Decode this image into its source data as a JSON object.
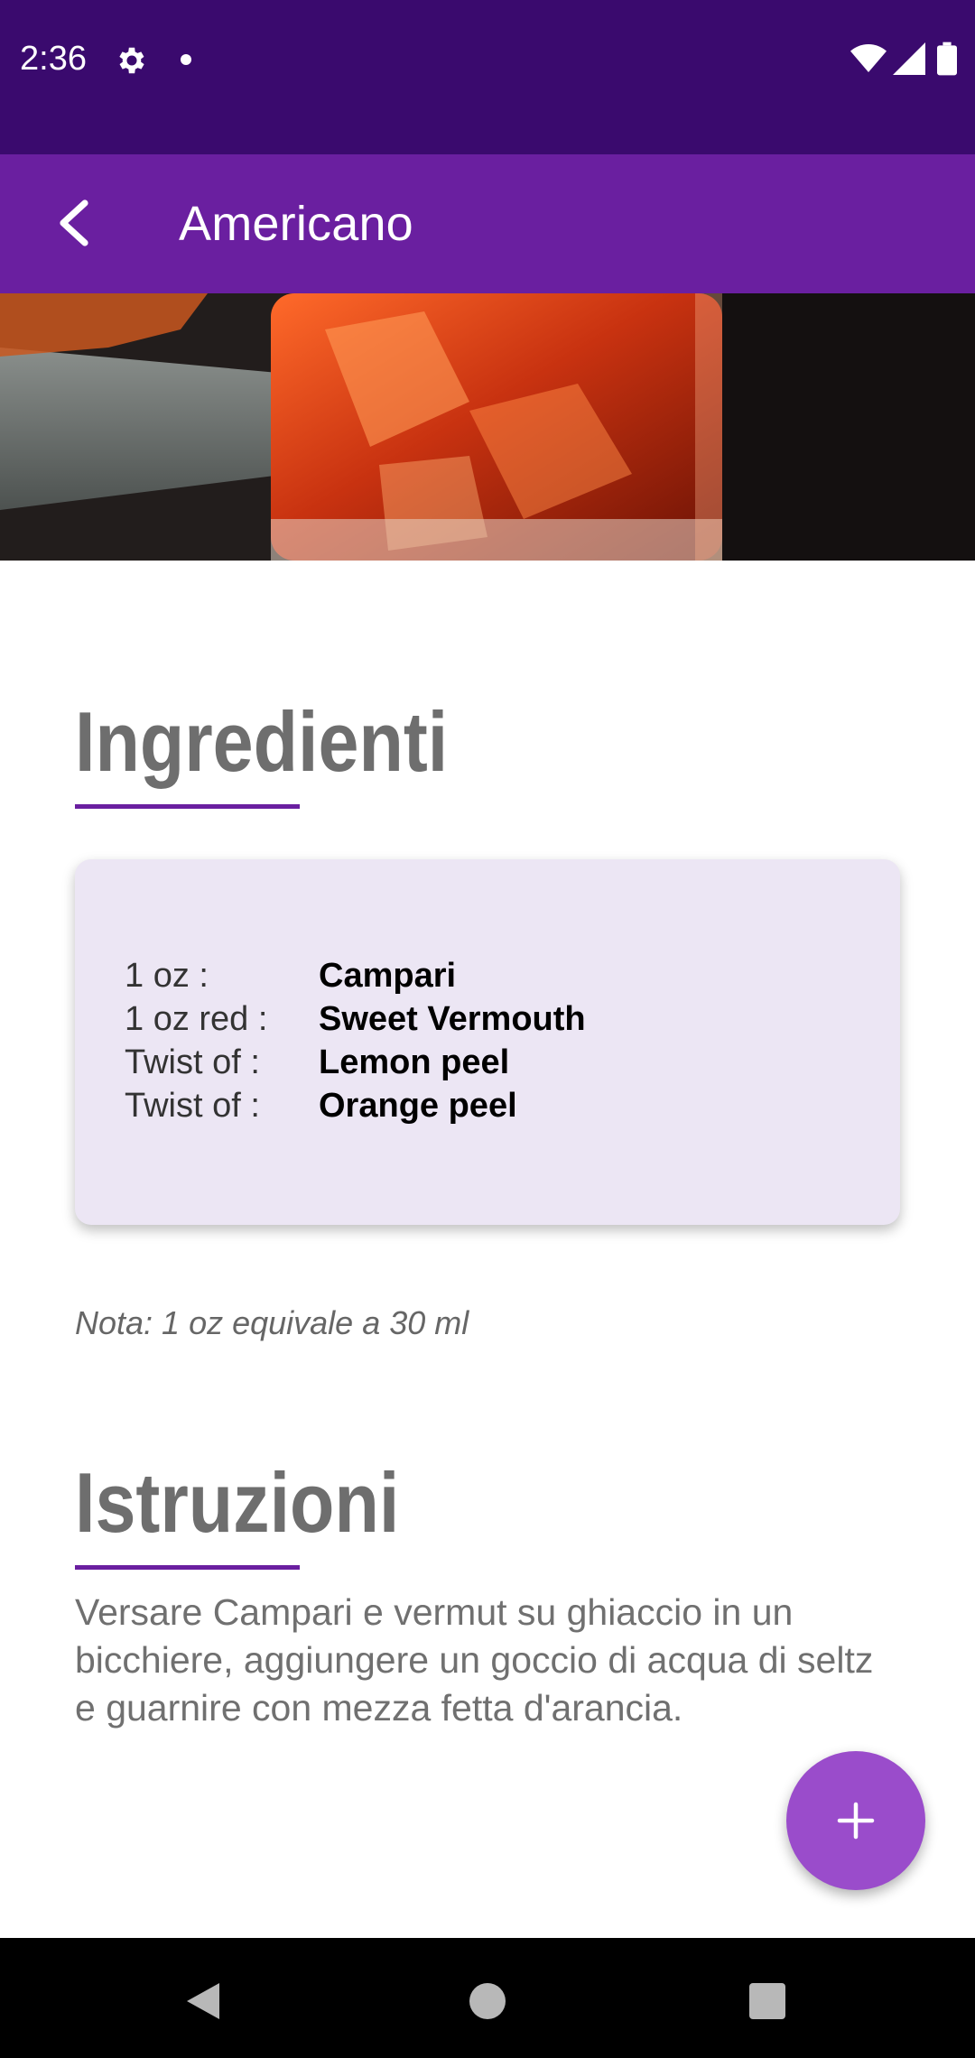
{
  "status_bar": {
    "time": "2:36"
  },
  "app_bar": {
    "title": "Americano"
  },
  "ingredients": {
    "title": "Ingredienti",
    "items": [
      {
        "qty": "1 oz :",
        "name": "Campari"
      },
      {
        "qty": "1 oz red :",
        "name": "Sweet Vermouth"
      },
      {
        "qty": "Twist of :",
        "name": "Lemon peel"
      },
      {
        "qty": "Twist of :",
        "name": "Orange peel"
      }
    ],
    "note": "Nota: 1 oz equivale a 30 ml"
  },
  "instructions": {
    "title": "Istruzioni",
    "text": "Versare Campari e vermut su ghiaccio in un bicchiere, aggiungere un goccio di acqua di seltz e guarnire con mezza fetta d'arancia."
  },
  "colors": {
    "status_bar": "#3a0a6e",
    "app_bar": "#6a1fa0",
    "accent": "#9a4ccb",
    "card": "#ece6f4"
  },
  "icons": {
    "status": [
      "settings-icon",
      "notification-dot-icon",
      "wifi-icon",
      "cell-signal-icon",
      "battery-icon"
    ],
    "app_bar": "back-arrow-icon",
    "fab": "plus-icon",
    "nav": [
      "nav-back-icon",
      "nav-home-icon",
      "nav-recents-icon"
    ]
  }
}
